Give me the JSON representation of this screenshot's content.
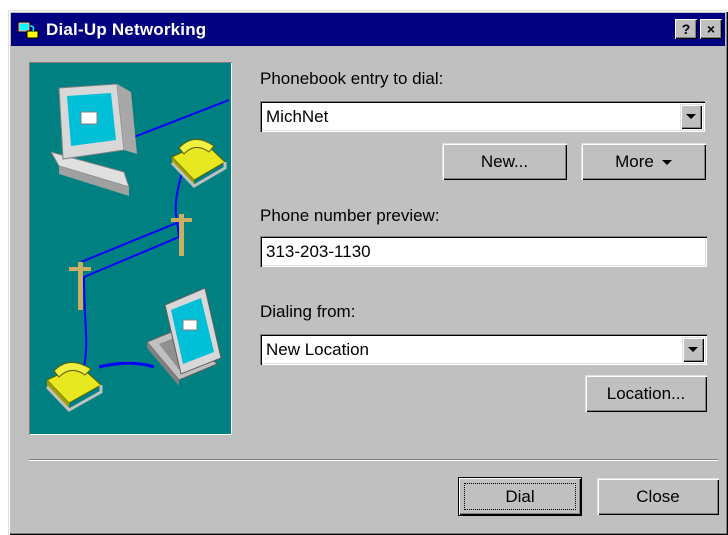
{
  "window": {
    "title": "Dial-Up Networking",
    "help_label": "?",
    "close_label": "×"
  },
  "phonebook": {
    "label": "Phonebook entry to dial:",
    "value": "MichNet",
    "new_button": "New...",
    "more_button": "More"
  },
  "preview": {
    "label": "Phone number preview:",
    "value": "313-203-1130"
  },
  "dialing": {
    "label": "Dialing from:",
    "value": "New Location",
    "location_button": "Location..."
  },
  "actions": {
    "dial_button": "Dial",
    "close_button": "Close"
  },
  "colors": {
    "titlebar": "#000080",
    "dialog_face": "#c0c0c0",
    "illustration_bg": "#008080",
    "cable": "#0000ff",
    "phone": "#ffff00"
  }
}
